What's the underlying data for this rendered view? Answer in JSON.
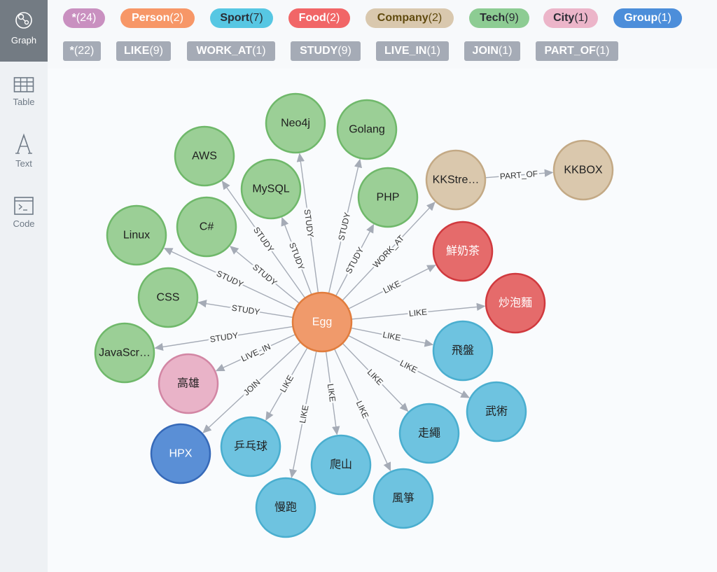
{
  "sidebar": {
    "items": [
      {
        "label": "Graph",
        "icon": "graph-icon"
      },
      {
        "label": "Table",
        "icon": "table-icon"
      },
      {
        "label": "Text",
        "icon": "text-icon"
      },
      {
        "label": "Code",
        "icon": "code-icon"
      }
    ]
  },
  "labels": [
    {
      "name": "*",
      "count": "(24)",
      "bg": "#c990c0",
      "fg": "#ffffff"
    },
    {
      "name": "Person",
      "count": "(2)",
      "bg": "#f79767",
      "fg": "#ffffff"
    },
    {
      "name": "Sport",
      "count": "(7)",
      "bg": "#57c7e3",
      "fg": "#2a2c34"
    },
    {
      "name": "Food",
      "count": "(2)",
      "bg": "#f16667",
      "fg": "#ffffff"
    },
    {
      "name": "Company",
      "count": "(2)",
      "bg": "#d9c8ae",
      "fg": "#604a0e"
    },
    {
      "name": "Tech",
      "count": "(9)",
      "bg": "#8dcc93",
      "fg": "#2a2c34"
    },
    {
      "name": "City",
      "count": "(1)",
      "bg": "#ecb5c9",
      "fg": "#2a2c34"
    },
    {
      "name": "Group",
      "count": "(1)",
      "bg": "#4c8eda",
      "fg": "#ffffff"
    }
  ],
  "relationships": [
    {
      "name": "*",
      "count": "(22)"
    },
    {
      "name": "LIKE",
      "count": "(9)"
    },
    {
      "name": "WORK_AT",
      "count": "(1)"
    },
    {
      "name": "STUDY",
      "count": "(9)"
    },
    {
      "name": "LIVE_IN",
      "count": "(1)"
    },
    {
      "name": "JOIN",
      "count": "(1)"
    },
    {
      "name": "PART_OF",
      "count": "(1)"
    }
  ],
  "colors": {
    "Person": {
      "fill": "#f09a6b",
      "stroke": "#e17c3c",
      "text": "#ffffff"
    },
    "Tech": {
      "fill": "#9bcf96",
      "stroke": "#6fb86a",
      "text": "#1f1f1f"
    },
    "Company": {
      "fill": "#dac8ad",
      "stroke": "#c3a985",
      "text": "#1f1f1f"
    },
    "Food": {
      "fill": "#e56b6b",
      "stroke": "#d0393e",
      "text": "#ffffff"
    },
    "Sport": {
      "fill": "#6ec3e0",
      "stroke": "#4aaecf",
      "text": "#1f1f1f"
    },
    "City": {
      "fill": "#e9b3c8",
      "stroke": "#d286a4",
      "text": "#1f1f1f"
    },
    "Group": {
      "fill": "#5a8fd6",
      "stroke": "#3669b8",
      "text": "#ffffff"
    }
  },
  "graph": {
    "nodes": [
      {
        "id": "egg",
        "label": "Egg",
        "type": "Person"
      },
      {
        "id": "neo4j",
        "label": "Neo4j",
        "type": "Tech"
      },
      {
        "id": "golang",
        "label": "Golang",
        "type": "Tech"
      },
      {
        "id": "aws",
        "label": "AWS",
        "type": "Tech"
      },
      {
        "id": "mysql",
        "label": "MySQL",
        "type": "Tech"
      },
      {
        "id": "php",
        "label": "PHP",
        "type": "Tech"
      },
      {
        "id": "csharp",
        "label": "C#",
        "type": "Tech"
      },
      {
        "id": "linux",
        "label": "Linux",
        "type": "Tech"
      },
      {
        "id": "css",
        "label": "CSS",
        "type": "Tech"
      },
      {
        "id": "js",
        "label": "JavaScr…",
        "type": "Tech"
      },
      {
        "id": "kkstre",
        "label": "KKStre…",
        "type": "Company"
      },
      {
        "id": "kkbox",
        "label": "KKBOX",
        "type": "Company"
      },
      {
        "id": "milktea",
        "label": "鮮奶茶",
        "type": "Food"
      },
      {
        "id": "noodle",
        "label": "炒泡麵",
        "type": "Food"
      },
      {
        "id": "frisbee",
        "label": "飛盤",
        "type": "Sport"
      },
      {
        "id": "wushu",
        "label": "武術",
        "type": "Sport"
      },
      {
        "id": "rope",
        "label": "走繩",
        "type": "Sport"
      },
      {
        "id": "kite",
        "label": "風箏",
        "type": "Sport"
      },
      {
        "id": "climb",
        "label": "爬山",
        "type": "Sport"
      },
      {
        "id": "jog",
        "label": "慢跑",
        "type": "Sport"
      },
      {
        "id": "pingpong",
        "label": "乒乓球",
        "type": "Sport"
      },
      {
        "id": "kaohsiung",
        "label": "高雄",
        "type": "City"
      },
      {
        "id": "hpx",
        "label": "HPX",
        "type": "Group"
      }
    ],
    "edges": [
      {
        "from": "egg",
        "to": "neo4j",
        "label": "STUDY"
      },
      {
        "from": "egg",
        "to": "golang",
        "label": "STUDY"
      },
      {
        "from": "egg",
        "to": "aws",
        "label": "STUDY"
      },
      {
        "from": "egg",
        "to": "mysql",
        "label": "STUDY"
      },
      {
        "from": "egg",
        "to": "php",
        "label": "STUDY"
      },
      {
        "from": "egg",
        "to": "csharp",
        "label": "STUDY"
      },
      {
        "from": "egg",
        "to": "linux",
        "label": "STUDY"
      },
      {
        "from": "egg",
        "to": "css",
        "label": "STUDY"
      },
      {
        "from": "egg",
        "to": "js",
        "label": "STUDY"
      },
      {
        "from": "egg",
        "to": "kkstre",
        "label": "WORK_AT"
      },
      {
        "from": "kkstre",
        "to": "kkbox",
        "label": "PART_OF"
      },
      {
        "from": "egg",
        "to": "milktea",
        "label": "LIKE"
      },
      {
        "from": "egg",
        "to": "noodle",
        "label": "LIKE"
      },
      {
        "from": "egg",
        "to": "frisbee",
        "label": "LIKE"
      },
      {
        "from": "egg",
        "to": "wushu",
        "label": "LIKE"
      },
      {
        "from": "egg",
        "to": "rope",
        "label": "LIKE"
      },
      {
        "from": "egg",
        "to": "kite",
        "label": "LIKE"
      },
      {
        "from": "egg",
        "to": "climb",
        "label": "LIKE"
      },
      {
        "from": "egg",
        "to": "jog",
        "label": "LIKE"
      },
      {
        "from": "egg",
        "to": "pingpong",
        "label": "LIKE"
      },
      {
        "from": "egg",
        "to": "kaohsiung",
        "label": "LIVE_IN"
      },
      {
        "from": "egg",
        "to": "hpx",
        "label": "JOIN"
      }
    ]
  }
}
